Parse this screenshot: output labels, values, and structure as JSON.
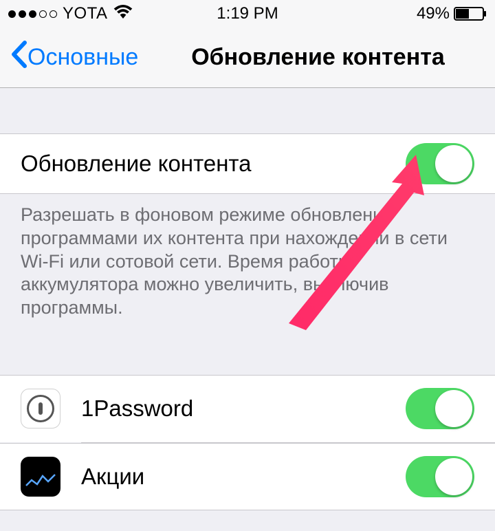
{
  "statusBar": {
    "carrier": "YOTA",
    "time": "1:19 PM",
    "batteryPercent": "49%"
  },
  "nav": {
    "backLabel": "Основные",
    "title": "Обновление контента"
  },
  "mainToggle": {
    "label": "Обновление контента",
    "on": true
  },
  "footerText": "Разрешать в фоновом режиме обновление программами их контента при нахождении в сети Wi-Fi или сотовой сети. Время работы аккумулятора можно увеличить, выключив программы.",
  "apps": [
    {
      "name": "1Password",
      "on": true,
      "iconType": "1password"
    },
    {
      "name": "Акции",
      "on": true,
      "iconType": "stocks"
    }
  ]
}
